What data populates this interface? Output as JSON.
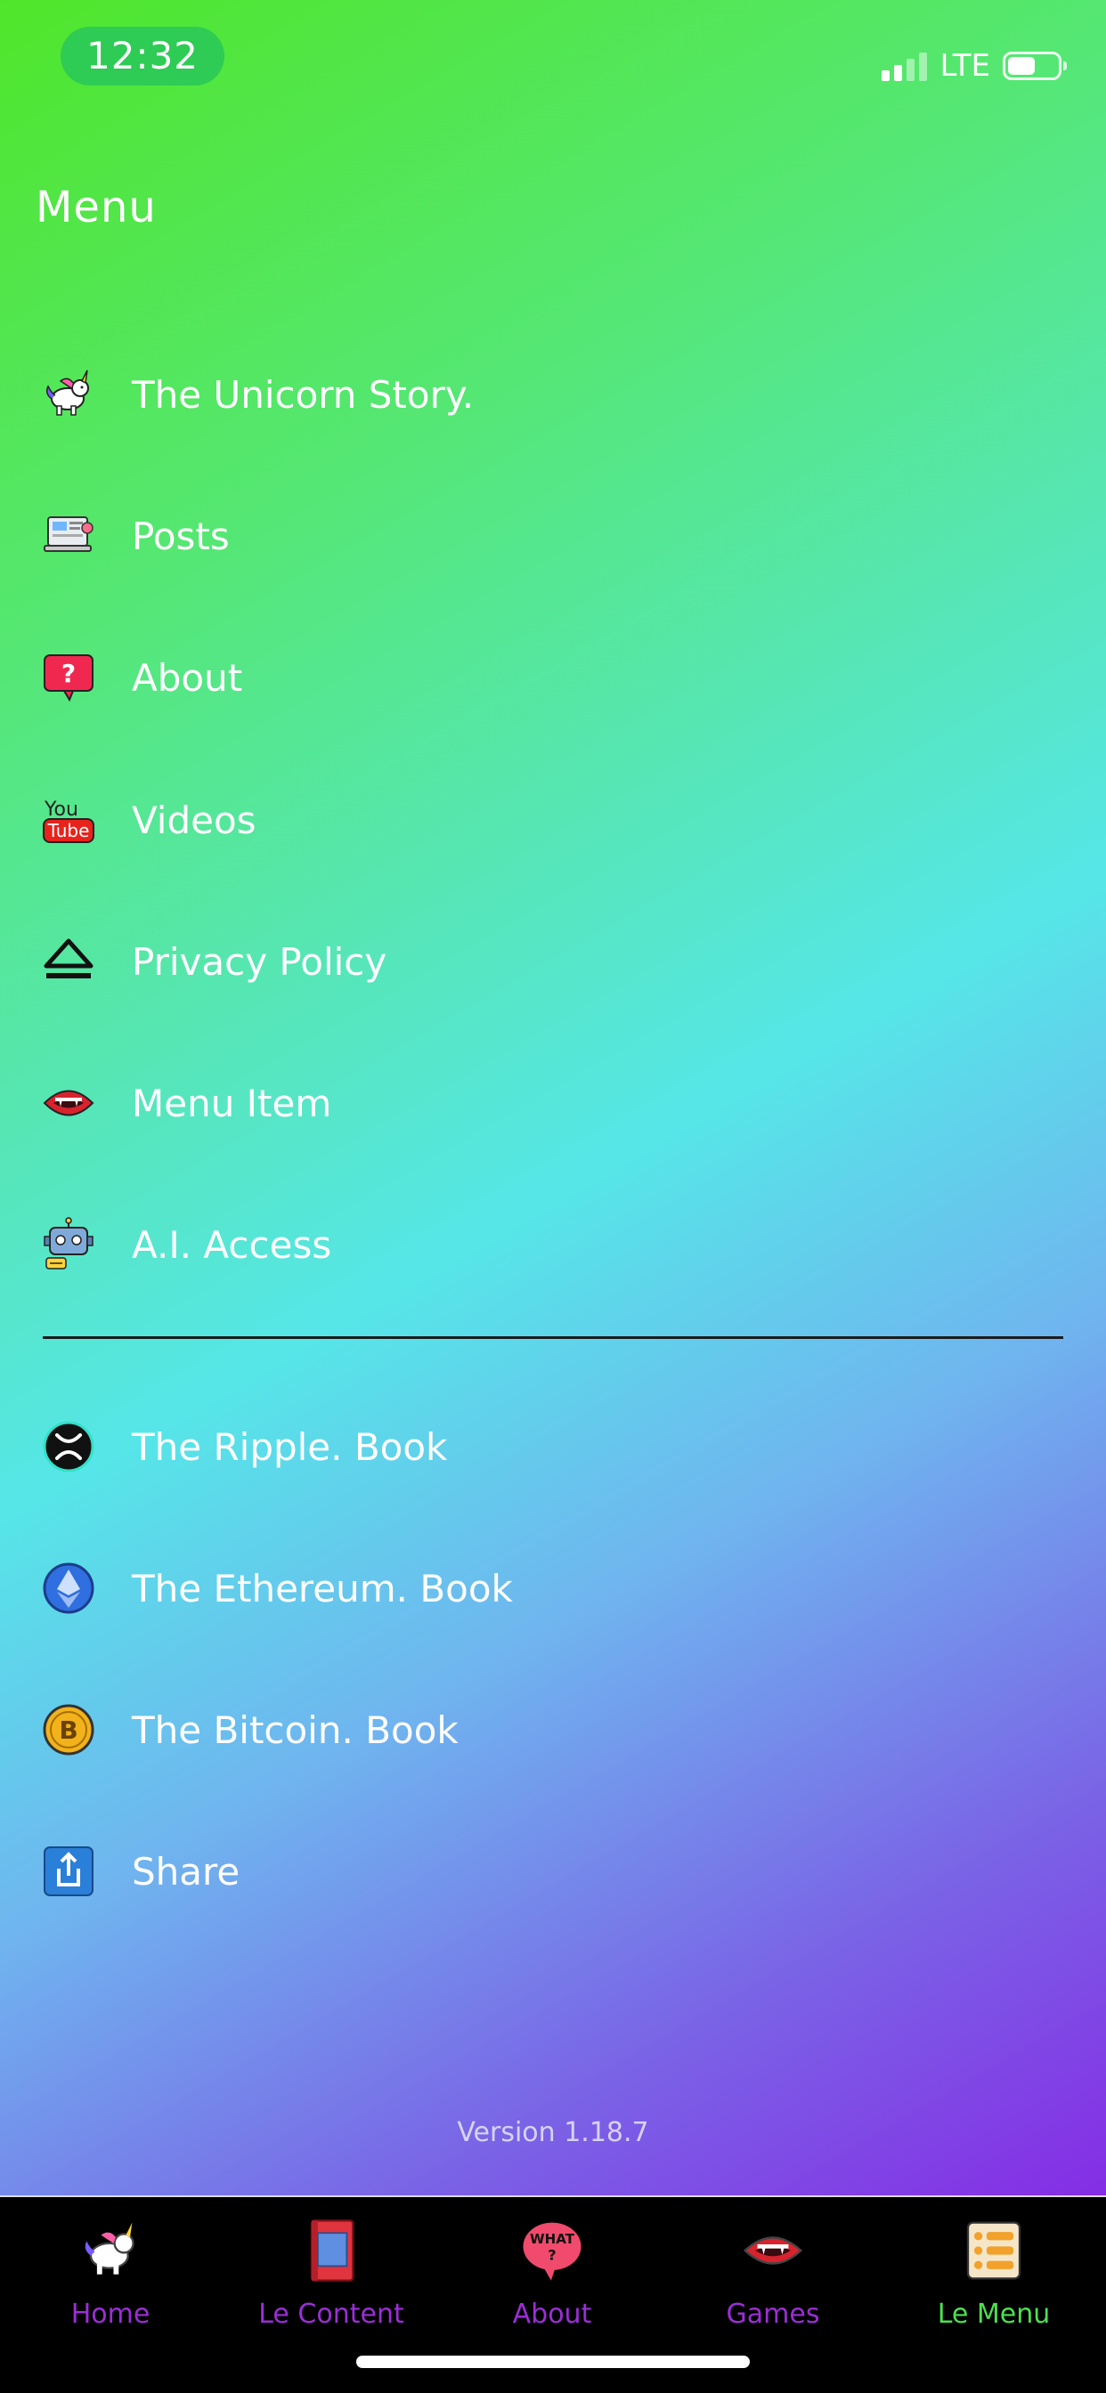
{
  "status_bar": {
    "time": "12:32",
    "network": "LTE"
  },
  "header": {
    "title": "Menu"
  },
  "menu": {
    "items": [
      {
        "label": "The Unicorn Story.",
        "icon": "unicorn-icon"
      },
      {
        "label": "Posts",
        "icon": "laptop-post-icon"
      },
      {
        "label": "About",
        "icon": "question-bubble-icon"
      },
      {
        "label": "Videos",
        "icon": "youtube-icon"
      },
      {
        "label": "Privacy Policy",
        "icon": "eject-icon"
      },
      {
        "label": "Menu Item",
        "icon": "vampire-mouth-icon"
      },
      {
        "label": "A.I. Access",
        "icon": "robot-icon"
      }
    ],
    "books": [
      {
        "label": "The Ripple. Book",
        "icon": "ripple-xrp-icon"
      },
      {
        "label": "The Ethereum. Book",
        "icon": "ethereum-icon"
      },
      {
        "label": "The Bitcoin. Book",
        "icon": "bitcoin-icon"
      },
      {
        "label": "Share",
        "icon": "share-icon"
      }
    ]
  },
  "footer": {
    "version": "Version 1.18.7"
  },
  "tabbar": {
    "tabs": [
      {
        "label": "Home",
        "icon": "unicorn-icon",
        "active": false
      },
      {
        "label": "Le Content",
        "icon": "book-icon",
        "active": false
      },
      {
        "label": "About",
        "icon": "what-bubble-icon",
        "active": false,
        "icon_text": "WHAT\n?"
      },
      {
        "label": "Games",
        "icon": "vampire-mouth-icon",
        "active": false
      },
      {
        "label": "Le Menu",
        "icon": "list-menu-icon",
        "active": true
      }
    ]
  },
  "colors": {
    "gradient_start": "#4fe62a",
    "gradient_mid": "#56e6e8",
    "gradient_end": "#8a12e4",
    "tab_label": "#9b2ed6",
    "tab_label_active": "#4de04d"
  }
}
